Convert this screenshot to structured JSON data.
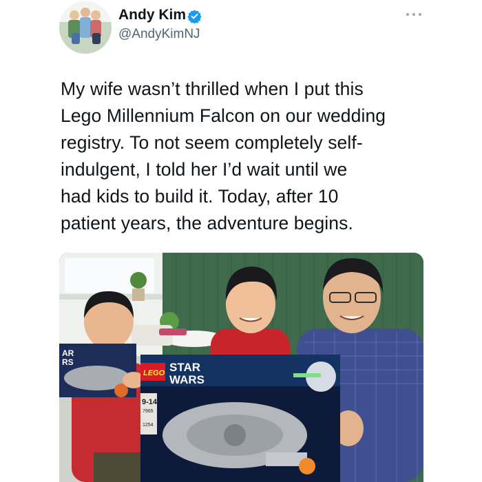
{
  "tweet": {
    "author": {
      "display_name": "Andy Kim",
      "handle": "@AndyKimNJ",
      "avatar_icon": "family-avatar-photo",
      "verified_icon": "verified-badge-icon",
      "verified_color": "#1d9bf0"
    },
    "more_icon": "more-options-icon",
    "text_lines": [
      "My wife wasn’t thrilled when I put this",
      "Lego Millennium Falcon on our wedding",
      "registry. To not seem completely self-",
      "indulgent, I told her I’d wait until we",
      "had kids to build it. Today, after 10",
      "patient years, the adventure begins."
    ],
    "media": {
      "box_brand": "LEGO",
      "box_title_top": "STAR",
      "box_title_bottom": "WARS",
      "age_range": "9-14",
      "set_number": "7965",
      "piece_count": "1254",
      "left_box_partial": "AR\nRS"
    }
  }
}
